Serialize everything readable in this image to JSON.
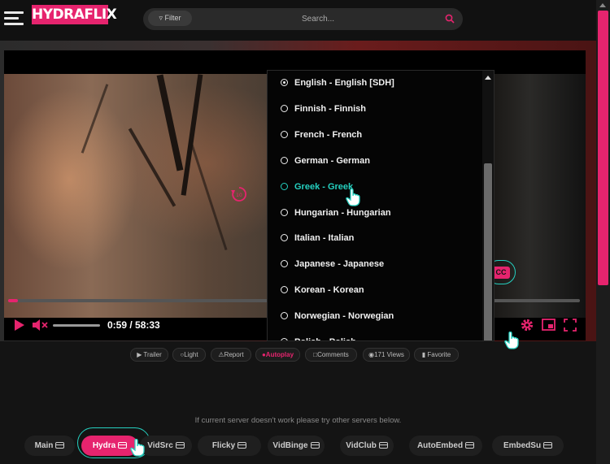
{
  "header": {
    "logo_text": "HYDRAFLIX",
    "filter_label": "Filter",
    "search_placeholder": "Search..."
  },
  "player": {
    "time": "0:59 / 58:33",
    "progress_fraction": 0.0168,
    "volume_fraction": 0.0,
    "cc_label": "CC"
  },
  "subtitles": {
    "items": [
      {
        "label": "English - English [SDH]",
        "checked": true
      },
      {
        "label": "Finnish - Finnish"
      },
      {
        "label": "French - French"
      },
      {
        "label": "German - German"
      },
      {
        "label": "Greek - Greek",
        "hovered": true
      },
      {
        "label": "Hungarian - Hungarian"
      },
      {
        "label": "Italian - Italian"
      },
      {
        "label": "Japanese - Japanese"
      },
      {
        "label": "Korean - Korean"
      },
      {
        "label": "Norwegian - Norwegian"
      },
      {
        "label": "Polish - Polish"
      }
    ]
  },
  "actions": {
    "trailer": "Trailer",
    "light": "Light",
    "report": "Report",
    "autoplay": "Autoplay",
    "comments": "Comments",
    "views": "171 Views",
    "favorite": "Favorite"
  },
  "servers": {
    "note": "If current server doesn't work please try other servers below.",
    "items": [
      "Main",
      "Hydra",
      "VidSrc",
      "Flicky",
      "VidBinge",
      "VidClub",
      "AutoEmbed",
      "EmbedSu"
    ],
    "active": "Hydra"
  },
  "colors": {
    "accent": "#e6246e",
    "highlight": "#25d0c0"
  }
}
